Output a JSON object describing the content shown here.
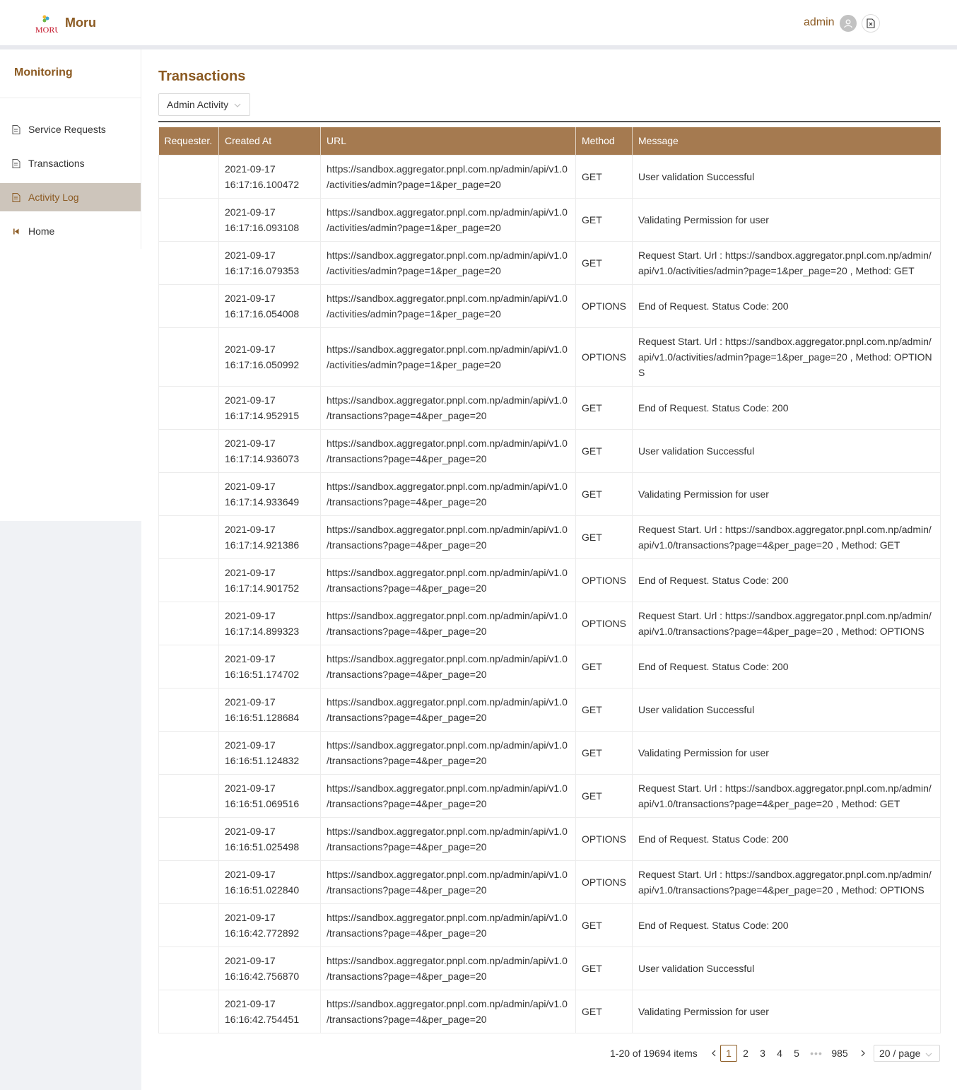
{
  "header": {
    "logo_text": "MORU",
    "brand": "Moru",
    "user": "admin"
  },
  "sidebar": {
    "title": "Monitoring",
    "items": [
      {
        "label": "Service Requests",
        "icon": "file-icon"
      },
      {
        "label": "Transactions",
        "icon": "file-icon"
      },
      {
        "label": "Activity Log",
        "icon": "file-icon",
        "active": true
      },
      {
        "label": "Home",
        "icon": "step-backward-icon"
      }
    ]
  },
  "page": {
    "title": "Transactions",
    "activity_select": "Admin Activity"
  },
  "table": {
    "columns": [
      "Requester.",
      "Created At",
      "URL",
      "Method",
      "Message"
    ],
    "rows": [
      {
        "requester": "",
        "created_date": "2021-09-17",
        "created_time": "16:17:16.100472",
        "url1": "https://sandbox.aggregator.pnpl.com.np/admin/api/v1.0",
        "url2": "/activities/admin?page=1&per_page=20",
        "method": "GET",
        "message": "User validation Successful"
      },
      {
        "requester": "",
        "created_date": "2021-09-17",
        "created_time": "16:17:16.093108",
        "url1": "https://sandbox.aggregator.pnpl.com.np/admin/api/v1.0",
        "url2": "/activities/admin?page=1&per_page=20",
        "method": "GET",
        "message": "Validating Permission for user"
      },
      {
        "requester": "",
        "created_date": "2021-09-17",
        "created_time": "16:17:16.079353",
        "url1": "https://sandbox.aggregator.pnpl.com.np/admin/api/v1.0",
        "url2": "/activities/admin?page=1&per_page=20",
        "method": "GET",
        "message": "Request Start. Url : https://sandbox.aggregator.pnpl.com.np/admin/api/v1.0/activities/admin?page=1&per_page=20 , Method: GET"
      },
      {
        "requester": "",
        "created_date": "2021-09-17",
        "created_time": "16:17:16.054008",
        "url1": "https://sandbox.aggregator.pnpl.com.np/admin/api/v1.0",
        "url2": "/activities/admin?page=1&per_page=20",
        "method": "OPTIONS",
        "message": "End of Request. Status Code: 200"
      },
      {
        "requester": "",
        "created_date": "2021-09-17",
        "created_time": "16:17:16.050992",
        "url1": "https://sandbox.aggregator.pnpl.com.np/admin/api/v1.0",
        "url2": "/activities/admin?page=1&per_page=20",
        "method": "OPTIONS",
        "message": "Request Start. Url : https://sandbox.aggregator.pnpl.com.np/admin/api/v1.0/activities/admin?page=1&per_page=20 , Method: OPTIONS"
      },
      {
        "requester": "",
        "created_date": "2021-09-17",
        "created_time": "16:17:14.952915",
        "url1": "https://sandbox.aggregator.pnpl.com.np/admin/api/v1.0",
        "url2": "/transactions?page=4&per_page=20",
        "method": "GET",
        "message": "End of Request. Status Code: 200"
      },
      {
        "requester": "",
        "created_date": "2021-09-17",
        "created_time": "16:17:14.936073",
        "url1": "https://sandbox.aggregator.pnpl.com.np/admin/api/v1.0",
        "url2": "/transactions?page=4&per_page=20",
        "method": "GET",
        "message": "User validation Successful"
      },
      {
        "requester": "",
        "created_date": "2021-09-17",
        "created_time": "16:17:14.933649",
        "url1": "https://sandbox.aggregator.pnpl.com.np/admin/api/v1.0",
        "url2": "/transactions?page=4&per_page=20",
        "method": "GET",
        "message": "Validating Permission for user"
      },
      {
        "requester": "",
        "created_date": "2021-09-17",
        "created_time": "16:17:14.921386",
        "url1": "https://sandbox.aggregator.pnpl.com.np/admin/api/v1.0",
        "url2": "/transactions?page=4&per_page=20",
        "method": "GET",
        "message": "Request Start. Url : https://sandbox.aggregator.pnpl.com.np/admin/api/v1.0/transactions?page=4&per_page=20 , Method: GET"
      },
      {
        "requester": "",
        "created_date": "2021-09-17",
        "created_time": "16:17:14.901752",
        "url1": "https://sandbox.aggregator.pnpl.com.np/admin/api/v1.0",
        "url2": "/transactions?page=4&per_page=20",
        "method": "OPTIONS",
        "message": "End of Request. Status Code: 200"
      },
      {
        "requester": "",
        "created_date": "2021-09-17",
        "created_time": "16:17:14.899323",
        "url1": "https://sandbox.aggregator.pnpl.com.np/admin/api/v1.0",
        "url2": "/transactions?page=4&per_page=20",
        "method": "OPTIONS",
        "message": "Request Start. Url : https://sandbox.aggregator.pnpl.com.np/admin/api/v1.0/transactions?page=4&per_page=20 , Method: OPTIONS"
      },
      {
        "requester": "",
        "created_date": "2021-09-17",
        "created_time": "16:16:51.174702",
        "url1": "https://sandbox.aggregator.pnpl.com.np/admin/api/v1.0",
        "url2": "/transactions?page=4&per_page=20",
        "method": "GET",
        "message": "End of Request. Status Code: 200"
      },
      {
        "requester": "",
        "created_date": "2021-09-17",
        "created_time": "16:16:51.128684",
        "url1": "https://sandbox.aggregator.pnpl.com.np/admin/api/v1.0",
        "url2": "/transactions?page=4&per_page=20",
        "method": "GET",
        "message": "User validation Successful"
      },
      {
        "requester": "",
        "created_date": "2021-09-17",
        "created_time": "16:16:51.124832",
        "url1": "https://sandbox.aggregator.pnpl.com.np/admin/api/v1.0",
        "url2": "/transactions?page=4&per_page=20",
        "method": "GET",
        "message": "Validating Permission for user"
      },
      {
        "requester": "",
        "created_date": "2021-09-17",
        "created_time": "16:16:51.069516",
        "url1": "https://sandbox.aggregator.pnpl.com.np/admin/api/v1.0",
        "url2": "/transactions?page=4&per_page=20",
        "method": "GET",
        "message": "Request Start. Url : https://sandbox.aggregator.pnpl.com.np/admin/api/v1.0/transactions?page=4&per_page=20 , Method: GET"
      },
      {
        "requester": "",
        "created_date": "2021-09-17",
        "created_time": "16:16:51.025498",
        "url1": "https://sandbox.aggregator.pnpl.com.np/admin/api/v1.0",
        "url2": "/transactions?page=4&per_page=20",
        "method": "OPTIONS",
        "message": "End of Request. Status Code: 200"
      },
      {
        "requester": "",
        "created_date": "2021-09-17",
        "created_time": "16:16:51.022840",
        "url1": "https://sandbox.aggregator.pnpl.com.np/admin/api/v1.0",
        "url2": "/transactions?page=4&per_page=20",
        "method": "OPTIONS",
        "message": "Request Start. Url : https://sandbox.aggregator.pnpl.com.np/admin/api/v1.0/transactions?page=4&per_page=20 , Method: OPTIONS"
      },
      {
        "requester": "",
        "created_date": "2021-09-17",
        "created_time": "16:16:42.772892",
        "url1": "https://sandbox.aggregator.pnpl.com.np/admin/api/v1.0",
        "url2": "/transactions?page=4&per_page=20",
        "method": "GET",
        "message": "End of Request. Status Code: 200"
      },
      {
        "requester": "",
        "created_date": "2021-09-17",
        "created_time": "16:16:42.756870",
        "url1": "https://sandbox.aggregator.pnpl.com.np/admin/api/v1.0",
        "url2": "/transactions?page=4&per_page=20",
        "method": "GET",
        "message": "User validation Successful"
      },
      {
        "requester": "",
        "created_date": "2021-09-17",
        "created_time": "16:16:42.754451",
        "url1": "https://sandbox.aggregator.pnpl.com.np/admin/api/v1.0",
        "url2": "/transactions?page=4&per_page=20",
        "method": "GET",
        "message": "Validating Permission for user"
      }
    ]
  },
  "pagination": {
    "total_text": "1-20 of 19694 items",
    "pages": [
      "1",
      "2",
      "3",
      "4",
      "5"
    ],
    "ellipsis": "•••",
    "last_page": "985",
    "current_page": "1",
    "page_size": "20 / page"
  },
  "colors": {
    "accent": "#8b5a22",
    "table_header": "#a57a50",
    "active_nav": "#cdc5bb"
  }
}
